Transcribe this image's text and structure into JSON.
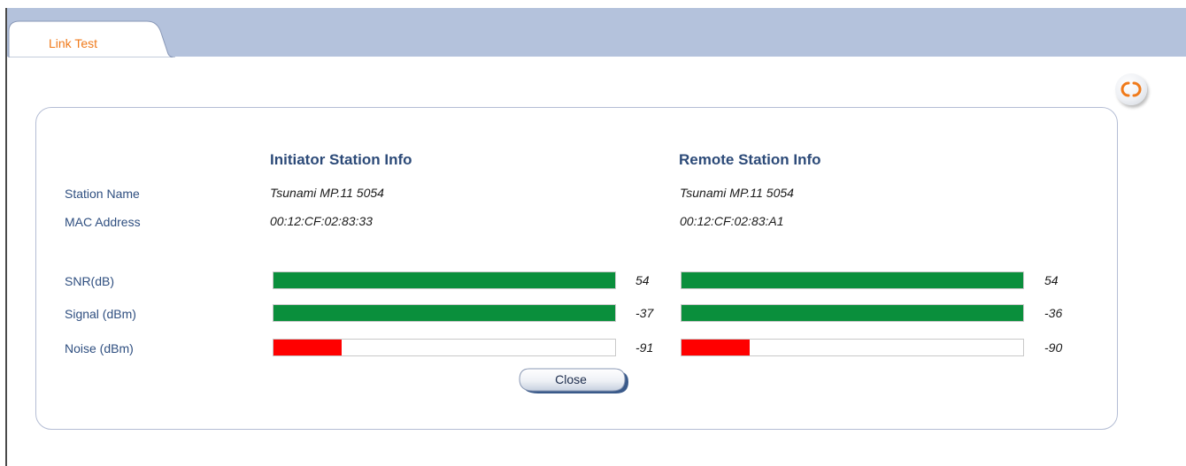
{
  "tabs": [
    {
      "label": "Link Test",
      "active": true
    }
  ],
  "toolbar": {
    "refresh_icon": "refresh-icon"
  },
  "initiator": {
    "heading": "Initiator Station Info",
    "station_name": "Tsunami MP.11 5054",
    "mac_address": "00:12:CF:02:83:33",
    "snr": {
      "value": "54",
      "level": 1.0
    },
    "signal": {
      "value": "-37",
      "level": 1.0
    },
    "noise": {
      "value": "-91",
      "level": 0.2
    }
  },
  "remote": {
    "heading": "Remote Station Info",
    "station_name": "Tsunami MP.11 5054",
    "mac_address": "00:12:CF:02:83:A1",
    "snr": {
      "value": "54",
      "level": 1.0
    },
    "signal": {
      "value": "-36",
      "level": 1.0
    },
    "noise": {
      "value": "-90",
      "level": 0.2
    }
  },
  "labels": {
    "station_name": "Station Name",
    "mac_address": "MAC Address",
    "snr": "SNR(dB)",
    "signal": "Signal (dBm)",
    "noise": "Noise (dBm)"
  },
  "colors": {
    "good": "#0a8f3c",
    "bad": "#ff0000",
    "accent": "#f07a1a",
    "label": "#2f4f80"
  },
  "close_label": "Close"
}
